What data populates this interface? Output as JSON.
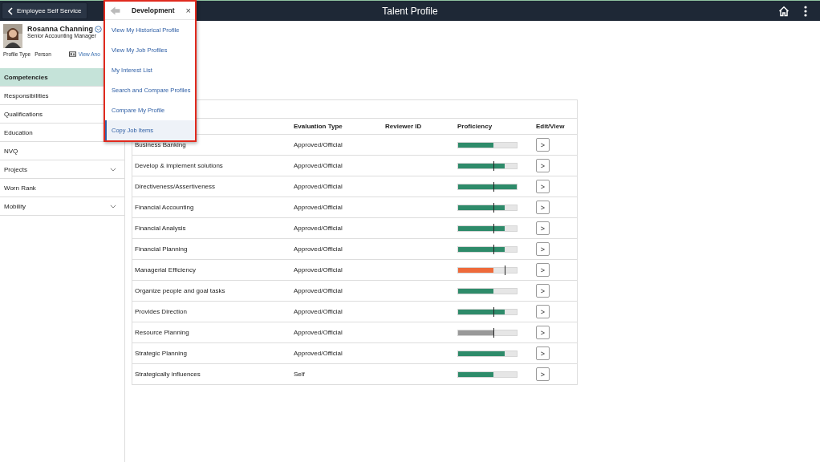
{
  "header": {
    "back_label": "Employee Self Service",
    "title": "Talent Profile"
  },
  "profile": {
    "name": "Rosanna Channing",
    "job_title": "Senior Accounting Manager",
    "type_label": "Profile Type",
    "type_value": "Person",
    "view_link": "View Ano"
  },
  "sidebar": {
    "items": [
      {
        "label": "Competencies",
        "selected": true,
        "expandable": false
      },
      {
        "label": "Responsibilities",
        "selected": false,
        "expandable": false
      },
      {
        "label": "Qualifications",
        "selected": false,
        "expandable": false
      },
      {
        "label": "Education",
        "selected": false,
        "expandable": false
      },
      {
        "label": "NVQ",
        "selected": false,
        "expandable": false
      },
      {
        "label": "Projects",
        "selected": false,
        "expandable": true
      },
      {
        "label": "Worn Rank",
        "selected": false,
        "expandable": false
      },
      {
        "label": "Mobility",
        "selected": false,
        "expandable": true
      }
    ]
  },
  "menu": {
    "title": "Development",
    "close": "×",
    "items": [
      {
        "label": "View My Historical Profile",
        "selected": false
      },
      {
        "label": "View My Job Profiles",
        "selected": false
      },
      {
        "label": "My Interest List",
        "selected": false
      },
      {
        "label": "Search and Compare Profiles",
        "selected": false
      },
      {
        "label": "Compare My Profile",
        "selected": false
      },
      {
        "label": "Copy Job Items",
        "selected": true
      }
    ]
  },
  "table": {
    "columns": [
      "Evaluation Type",
      "Reviewer ID",
      "Proficiency",
      "Edit/View"
    ],
    "rows": [
      {
        "name": "Business Banking",
        "evaluation": "Approved/Official",
        "level": 0.6,
        "color": "#2e8b6a",
        "mark_middle": false,
        "mark_right": false,
        "action": ">"
      },
      {
        "name": "Develop & implement solutions",
        "evaluation": "Approved/Official",
        "level": 0.8,
        "color": "#2e8b6a",
        "mark_middle": true,
        "mark_right": false,
        "action": ">"
      },
      {
        "name": "Directiveness/Assertiveness",
        "evaluation": "Approved/Official",
        "level": 1,
        "color": "#2e8b6a",
        "mark_middle": true,
        "mark_right": false,
        "action": ">"
      },
      {
        "name": "Financial Accounting",
        "evaluation": "Approved/Official",
        "level": 0.8,
        "color": "#2e8b6a",
        "mark_middle": true,
        "mark_right": false,
        "action": ">"
      },
      {
        "name": "Financial Analysis",
        "evaluation": "Approved/Official",
        "level": 0.8,
        "color": "#2e8b6a",
        "mark_middle": true,
        "mark_right": false,
        "action": ">"
      },
      {
        "name": "Financial Planning",
        "evaluation": "Approved/Official",
        "level": 0.8,
        "color": "#2e8b6a",
        "mark_middle": true,
        "mark_right": false,
        "action": ">"
      },
      {
        "name": "Managerial Efficiency",
        "evaluation": "Approved/Official",
        "level": 0.6,
        "color": "#ee6a3a",
        "mark_middle": false,
        "mark_right": true,
        "action": ">"
      },
      {
        "name": "Organize people and goal tasks",
        "evaluation": "Approved/Official",
        "level": 0.6,
        "color": "#2e8b6a",
        "mark_middle": false,
        "mark_right": false,
        "action": ">"
      },
      {
        "name": "Provides Direction",
        "evaluation": "Approved/Official",
        "level": 0.8,
        "color": "#2e8b6a",
        "mark_middle": true,
        "mark_right": false,
        "action": ">"
      },
      {
        "name": "Resource Planning",
        "evaluation": "Approved/Official",
        "level": 0.6,
        "color": "#999999",
        "mark_middle": true,
        "mark_right": false,
        "action": ">"
      },
      {
        "name": "Strategic Planning",
        "evaluation": "Approved/Official",
        "level": 0.8,
        "color": "#2e8b6a",
        "mark_middle": false,
        "mark_right": false,
        "action": ">"
      },
      {
        "name": "Strategically influences",
        "evaluation": "Self",
        "level": 0.6,
        "color": "#2e8b6a",
        "mark_middle": false,
        "mark_right": false,
        "action": ">"
      }
    ]
  }
}
